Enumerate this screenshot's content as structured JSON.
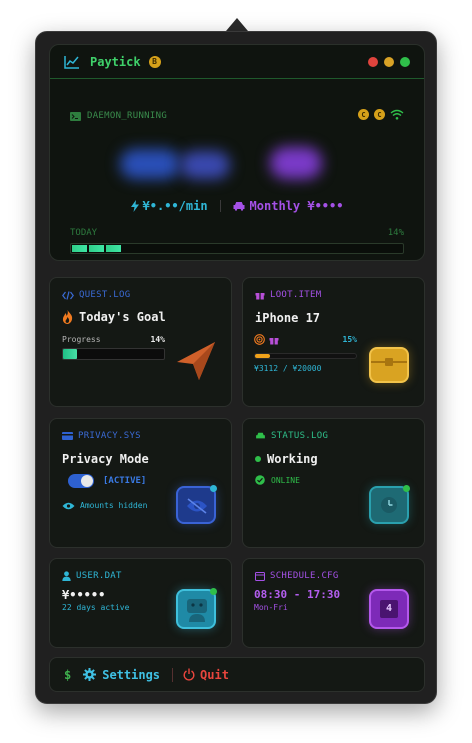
{
  "app": {
    "title": "Paytick",
    "badge_glyph": "B"
  },
  "hero": {
    "daemon_status": "DAEMON_RUNNING",
    "coin_glyph": "C",
    "rate_per_min": "¥•.••/min",
    "rate_monthly": "Monthly ¥••••",
    "today_label": "TODAY",
    "today_pct_text": "14%",
    "today_progress": 0.14
  },
  "cards": {
    "quest": {
      "head": "QUEST.LOG",
      "title": "Today's Goal",
      "progress_label": "Progress",
      "progress_pct_text": "14%",
      "progress": 0.14
    },
    "loot": {
      "head": "LOOT.ITEM",
      "title": "iPhone 17",
      "pct_text": "15%",
      "progress": 0.15,
      "amount": "¥3112 / ¥20000"
    },
    "privacy": {
      "head": "PRIVACY.SYS",
      "title": "Privacy Mode",
      "toggle_state": "[ACTIVE]",
      "hint": "Amounts hidden"
    },
    "status": {
      "head": "STATUS.LOG",
      "title": "Working",
      "online": "ONLINE"
    },
    "user": {
      "head": "USER.DAT",
      "balance": "¥•••••",
      "active": "22 days active"
    },
    "schedule": {
      "head": "SCHEDULE.CFG",
      "time": "08:30 - 17:30",
      "days": "Mon-Fri",
      "calendar_glyph": "4"
    }
  },
  "footer": {
    "prompt": "$",
    "settings_label": "Settings",
    "quit_label": "Quit"
  },
  "colors": {
    "accent_green": "#3fd16a",
    "accent_cyan": "#2fb6d6",
    "accent_purple": "#a451e6",
    "accent_orange": "#f0a21a",
    "accent_red": "#e8453d",
    "traffic_red": "#e0443d",
    "traffic_yellow": "#d9a326",
    "traffic_green": "#2fbf4a"
  }
}
